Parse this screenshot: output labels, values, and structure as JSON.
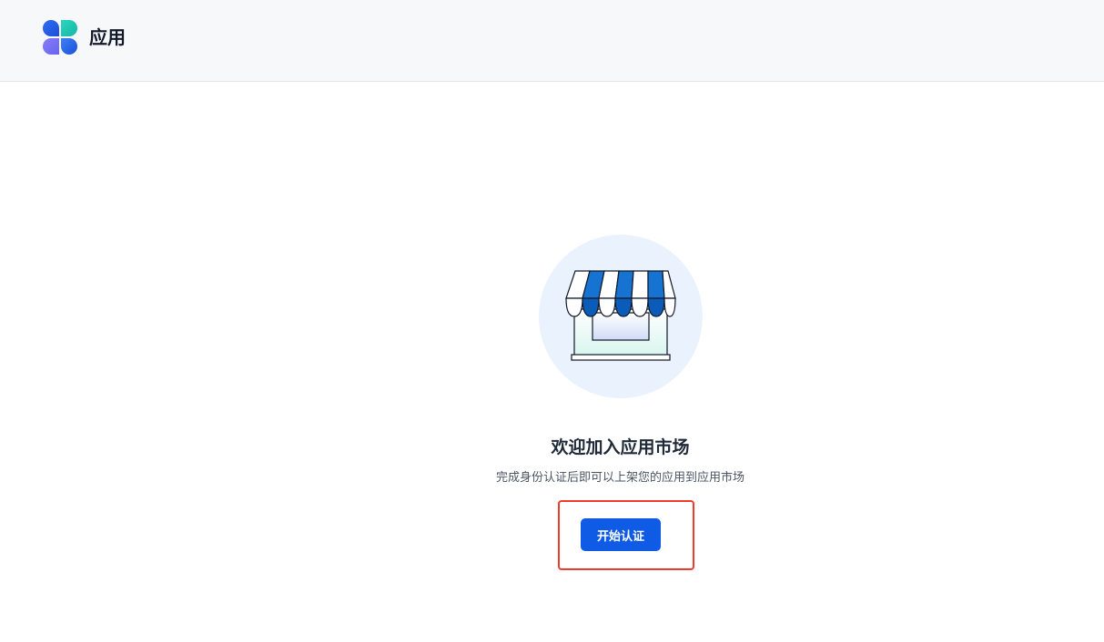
{
  "header": {
    "app_title": "应用",
    "logo_icon": "app-logo-icon"
  },
  "main": {
    "illustration_icon": "storefront-icon",
    "title": "欢迎加入应用市场",
    "subtitle": "完成身份认证后即可以上架您的应用到应用市场",
    "start_button_label": "开始认证"
  },
  "colors": {
    "accent": "#0f5be6",
    "highlight": "#ef3b2d",
    "header_bg": "#f7f8fa",
    "hero_bg": "#eaf2fd"
  }
}
